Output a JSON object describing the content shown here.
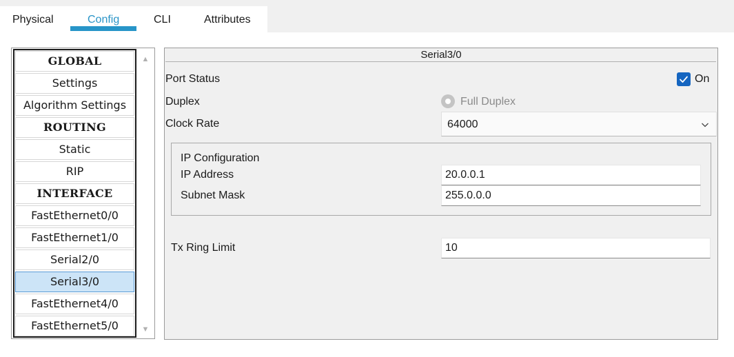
{
  "tabs": {
    "physical": "Physical",
    "config": "Config",
    "cli": "CLI",
    "attributes": "Attributes",
    "active_color": "#2795c8"
  },
  "sidebar": {
    "items": [
      {
        "label": "GLOBAL",
        "type": "header"
      },
      {
        "label": "Settings",
        "type": "item"
      },
      {
        "label": "Algorithm Settings",
        "type": "item"
      },
      {
        "label": "ROUTING",
        "type": "header"
      },
      {
        "label": "Static",
        "type": "item"
      },
      {
        "label": "RIP",
        "type": "item"
      },
      {
        "label": "INTERFACE",
        "type": "header"
      },
      {
        "label": "FastEthernet0/0",
        "type": "item"
      },
      {
        "label": "FastEthernet1/0",
        "type": "item"
      },
      {
        "label": "Serial2/0",
        "type": "item"
      },
      {
        "label": "Serial3/0",
        "type": "item",
        "selected": true
      },
      {
        "label": "FastEthernet4/0",
        "type": "item"
      },
      {
        "label": "FastEthernet5/0",
        "type": "item"
      }
    ],
    "scroll_up_icon": "arrow-up-icon",
    "scroll_down_icon": "arrow-down-icon"
  },
  "panel": {
    "title": "Serial3/0",
    "port_status": {
      "label": "Port Status",
      "checkbox_label": "On",
      "checked": true,
      "checkbox_color": "#1565c0"
    },
    "duplex": {
      "label": "Duplex",
      "option_label": "Full Duplex",
      "disabled": true
    },
    "clock_rate": {
      "label": "Clock Rate",
      "value": "64000",
      "icon": "chevron-down-icon"
    },
    "ip_config": {
      "title": "IP Configuration",
      "ip_address_label": "IP Address",
      "ip_address_value": "20.0.0.1",
      "subnet_mask_label": "Subnet Mask",
      "subnet_mask_value": "255.0.0.0"
    },
    "tx_ring_limit": {
      "label": "Tx Ring Limit",
      "value": "10"
    }
  }
}
